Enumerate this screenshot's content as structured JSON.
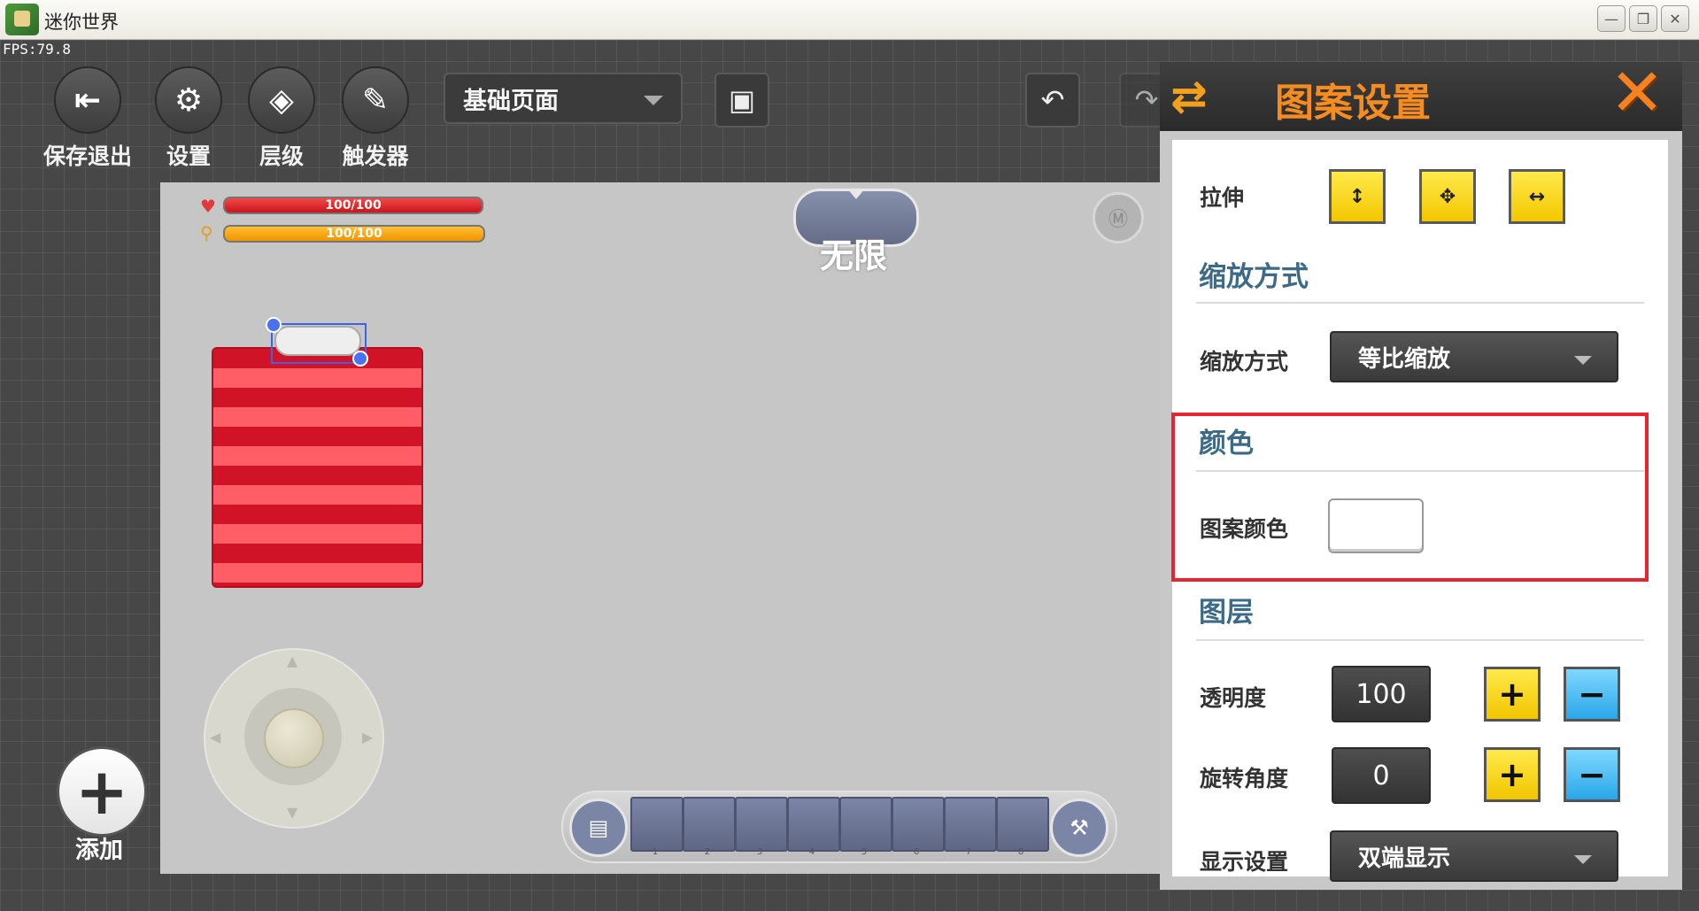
{
  "window": {
    "title": "迷你世界",
    "fps": "FPS:79.8"
  },
  "toolbar": {
    "save_exit": "保存退出",
    "settings": "设置",
    "layers": "层级",
    "trigger": "触发器",
    "page_select": "基础页面"
  },
  "canvas": {
    "hp": "100/100",
    "hunger": "100/100",
    "unlimited": "无限",
    "slots": [
      "1",
      "2",
      "3",
      "4",
      "5",
      "6",
      "7",
      "8"
    ],
    "add_label": "添加"
  },
  "panel": {
    "title": "图案设置",
    "stretch_label": "拉伸",
    "scale_section": "缩放方式",
    "scale_label": "缩放方式",
    "scale_value": "等比缩放",
    "color_section": "颜色",
    "pattern_color_label": "图案颜色",
    "pattern_color_value": "#ffffff",
    "layer_section": "图层",
    "opacity_label": "透明度",
    "opacity_value": "100",
    "rotation_label": "旋转角度",
    "rotation_value": "0",
    "display_label": "显示设置",
    "display_value": "双端显示"
  },
  "colors": {
    "accent": "#f68c1f",
    "highlight": "#e8252f",
    "section": "#3d6a86"
  }
}
